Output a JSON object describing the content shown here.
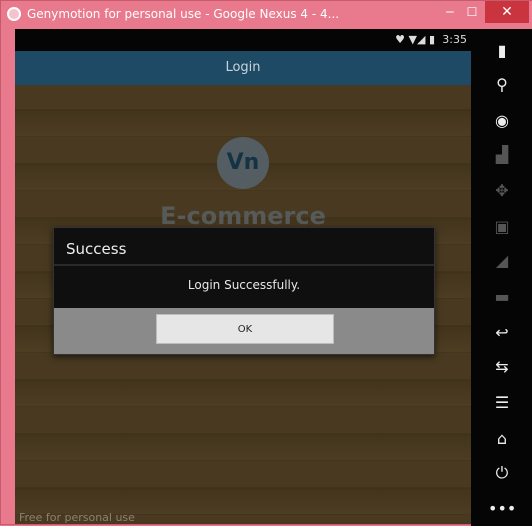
{
  "window": {
    "title": "Genymotion for personal use - Google Nexus 4 - 4...",
    "controls": {
      "minimize": "‒",
      "maximize": "☐",
      "close": "✕"
    }
  },
  "device": {
    "statusbar": {
      "icons": "♥ ▼◢ ▮",
      "time": "3:35"
    },
    "actionbar": {
      "title": "Login"
    },
    "logo_text": "Vn",
    "brand": "E-commerce",
    "watermark": "Free for personal use"
  },
  "dialog": {
    "title": "Success",
    "message": "Login Successfully.",
    "ok_label": "OK"
  },
  "sidebar": {
    "items": [
      {
        "icon": "battery-icon",
        "glyph": "▮",
        "enabled": true
      },
      {
        "icon": "gps-icon",
        "glyph": "⚲",
        "enabled": true
      },
      {
        "icon": "webcam-icon",
        "glyph": "◉",
        "enabled": true
      },
      {
        "icon": "remote-control-icon",
        "glyph": "▟",
        "enabled": false
      },
      {
        "icon": "move-icon",
        "glyph": "✥",
        "enabled": false
      },
      {
        "icon": "identifiers-icon",
        "glyph": "▣",
        "enabled": false
      },
      {
        "icon": "network-icon",
        "glyph": "◢",
        "enabled": false
      },
      {
        "icon": "sms-icon",
        "glyph": "▬",
        "enabled": false
      },
      {
        "icon": "back-icon",
        "glyph": "↩",
        "enabled": true
      },
      {
        "icon": "recent-apps-icon",
        "glyph": "⇆",
        "enabled": true
      },
      {
        "icon": "menu-icon",
        "glyph": "☰",
        "enabled": true
      },
      {
        "icon": "home-icon",
        "glyph": "⌂",
        "enabled": true
      },
      {
        "icon": "power-icon",
        "glyph": "⏻",
        "enabled": true
      },
      {
        "icon": "more-icon",
        "glyph": "•••",
        "enabled": true
      }
    ]
  }
}
